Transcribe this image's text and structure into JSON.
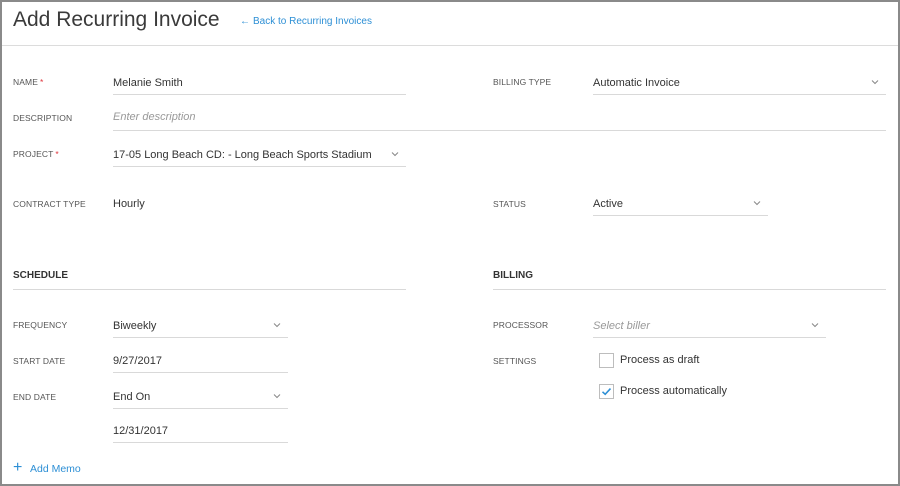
{
  "header": {
    "title": "Add Recurring Invoice",
    "back_link": "Back to Recurring Invoices",
    "back_arrow": "←"
  },
  "form": {
    "name": {
      "label": "NAME",
      "required_mark": "*",
      "value": "Melanie Smith"
    },
    "billing_type": {
      "label": "BILLING TYPE",
      "value": "Automatic Invoice"
    },
    "description": {
      "label": "DESCRIPTION",
      "placeholder": "Enter description"
    },
    "project": {
      "label": "PROJECT",
      "required_mark": "*",
      "value": "17-05 Long Beach CD: - Long Beach Sports Stadium"
    },
    "contract_type": {
      "label": "CONTRACT TYPE",
      "value": "Hourly"
    },
    "status": {
      "label": "STATUS",
      "value": "Active"
    }
  },
  "schedule": {
    "title": "SCHEDULE",
    "frequency": {
      "label": "FREQUENCY",
      "value": "Biweekly"
    },
    "start_date": {
      "label": "START DATE",
      "value": "9/27/2017"
    },
    "end_date": {
      "label": "END DATE",
      "value": "End On",
      "date_value": "12/31/2017"
    }
  },
  "billing": {
    "title": "BILLING",
    "processor": {
      "label": "PROCESSOR",
      "placeholder": "Select biller"
    },
    "settings": {
      "label": "SETTINGS",
      "process_as_draft": {
        "label": "Process as draft",
        "checked": false
      },
      "process_automatically": {
        "label": "Process automatically",
        "checked": true
      }
    }
  },
  "actions": {
    "add_memo": "Add Memo",
    "add_memo_icon": "+"
  },
  "colors": {
    "accent": "#2d8fd5",
    "required": "#e0363d",
    "border": "#d9d9d9"
  }
}
